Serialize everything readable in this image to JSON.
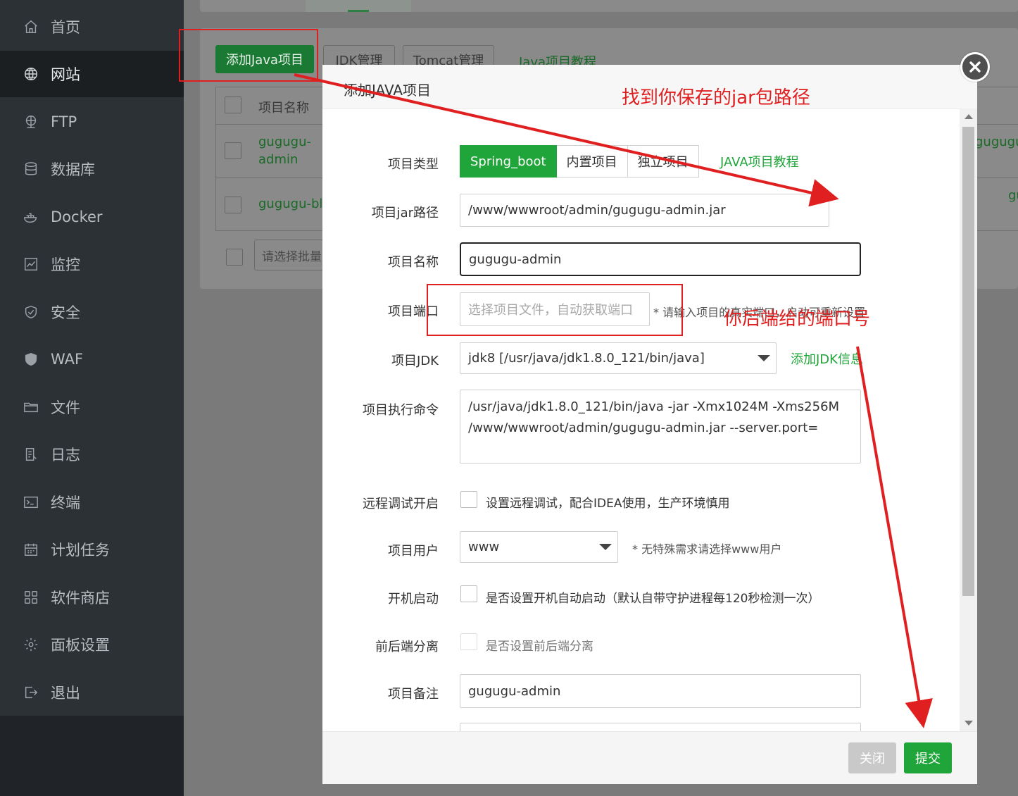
{
  "sidebar": {
    "items": [
      {
        "label": "首页",
        "icon": "home-icon"
      },
      {
        "label": "网站",
        "icon": "globe-icon"
      },
      {
        "label": "FTP",
        "icon": "ftp-icon"
      },
      {
        "label": "数据库",
        "icon": "database-icon"
      },
      {
        "label": "Docker",
        "icon": "docker-icon"
      },
      {
        "label": "监控",
        "icon": "monitor-icon"
      },
      {
        "label": "安全",
        "icon": "shield-check-icon"
      },
      {
        "label": "WAF",
        "icon": "shield-icon"
      },
      {
        "label": "文件",
        "icon": "folder-icon"
      },
      {
        "label": "日志",
        "icon": "log-icon"
      },
      {
        "label": "终端",
        "icon": "terminal-icon"
      },
      {
        "label": "计划任务",
        "icon": "calendar-icon"
      },
      {
        "label": "软件商店",
        "icon": "apps-icon"
      },
      {
        "label": "面板设置",
        "icon": "gear-icon"
      },
      {
        "label": "退出",
        "icon": "logout-icon"
      }
    ],
    "active": "网站"
  },
  "background": {
    "add_java_button": "添加Java项目",
    "jdk_button": "JDK管理",
    "tomcat_button": "Tomcat管理",
    "tutorial_link": "Java项目教程",
    "table_header": "项目名称",
    "rows": [
      {
        "name_line1": "gugugu-",
        "name_line2": "admin",
        "right_text": "gugugu-"
      },
      {
        "name_line1": "gugugu-bl",
        "name_line2": "",
        "right_text": "gugu-"
      }
    ],
    "batch_placeholder": "请选择批量"
  },
  "modal": {
    "title": "添加JAVA项目",
    "project_type": {
      "label": "项目类型",
      "options": [
        "Spring_boot",
        "内置项目",
        "独立项目"
      ],
      "selected": "Spring_boot",
      "tutorial_link": "JAVA项目教程"
    },
    "jar_path": {
      "label": "项目jar路径",
      "value": "/www/wwwroot/admin/gugugu-admin.jar"
    },
    "name": {
      "label": "项目名称",
      "value": "gugugu-admin"
    },
    "port": {
      "label": "项目端口",
      "placeholder": "选择项目文件，自动获取端口",
      "hint": "* 请输入项目的真实端口，启动可重新设置"
    },
    "jdk": {
      "label": "项目JDK",
      "value": "jdk8 [/usr/java/jdk1.8.0_121/bin/java]",
      "add_link": "添加JDK信息"
    },
    "command": {
      "label": "项目执行命令",
      "line1": "/usr/java/jdk1.8.0_121/bin/java -jar -Xmx1024M -Xms256M",
      "line2": "/www/wwwroot/admin/gugugu-admin.jar --server.port="
    },
    "remote_debug": {
      "label": "远程调试开启",
      "text": "设置远程调试，配合IDEA使用，生产环境慎用",
      "checked": false
    },
    "user": {
      "label": "项目用户",
      "value": "www",
      "hint": "* 无特殊需求请选择www用户"
    },
    "autostart": {
      "label": "开机启动",
      "text": "是否设置开机自动启动（默认自带守护进程每120秒检测一次）",
      "checked": false
    },
    "separation": {
      "label": "前后端分离",
      "text": "是否设置前后端分离",
      "checked": false
    },
    "remark": {
      "label": "项目备注",
      "value": "gugugu-admin"
    },
    "close_button": "关闭",
    "submit_button": "提交"
  },
  "annotations": {
    "jar_note": "找到你保存的jar包路径",
    "port_note": "你后端给的端口号",
    "color": "#e02020"
  },
  "colors": {
    "accent": "#20a53a",
    "sidebar_bg": "#2c3136"
  }
}
